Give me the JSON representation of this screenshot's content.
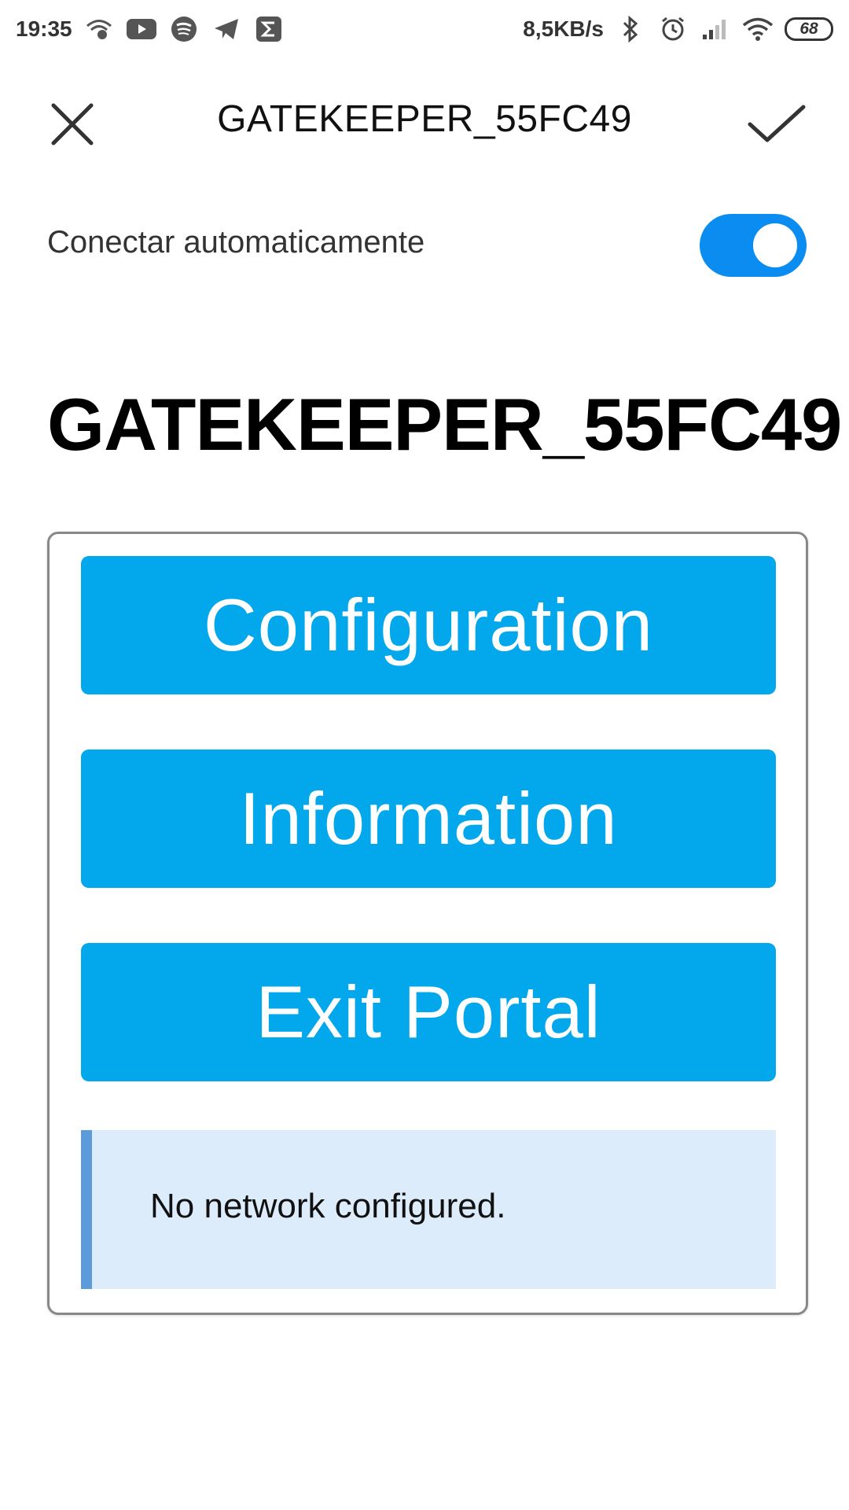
{
  "status_bar": {
    "time": "19:35",
    "net_speed": "8,5KB/s",
    "battery": "68",
    "left_icons": [
      "wifi-assist-icon",
      "youtube-icon",
      "spotify-icon",
      "telegram-icon",
      "sigma-icon"
    ],
    "right_icons": [
      "bluetooth-icon",
      "alarm-icon",
      "signal-icon",
      "wifi-icon"
    ]
  },
  "app_bar": {
    "title": "GATEKEEPER_55FC49",
    "close_icon": "close-icon",
    "confirm_icon": "check-icon"
  },
  "auto_connect": {
    "label": "Conectar automaticamente",
    "enabled": true,
    "toggle_color": "#0a8cf0"
  },
  "portal": {
    "heading": "GATEKEEPER_55FC49",
    "buttons": [
      {
        "label": "Configuration"
      },
      {
        "label": "Information"
      },
      {
        "label": "Exit Portal"
      }
    ],
    "button_color": "#03a7ec",
    "message": "No network configured.",
    "message_bg": "#dcecfb",
    "message_accent": "#5b9bdb"
  }
}
